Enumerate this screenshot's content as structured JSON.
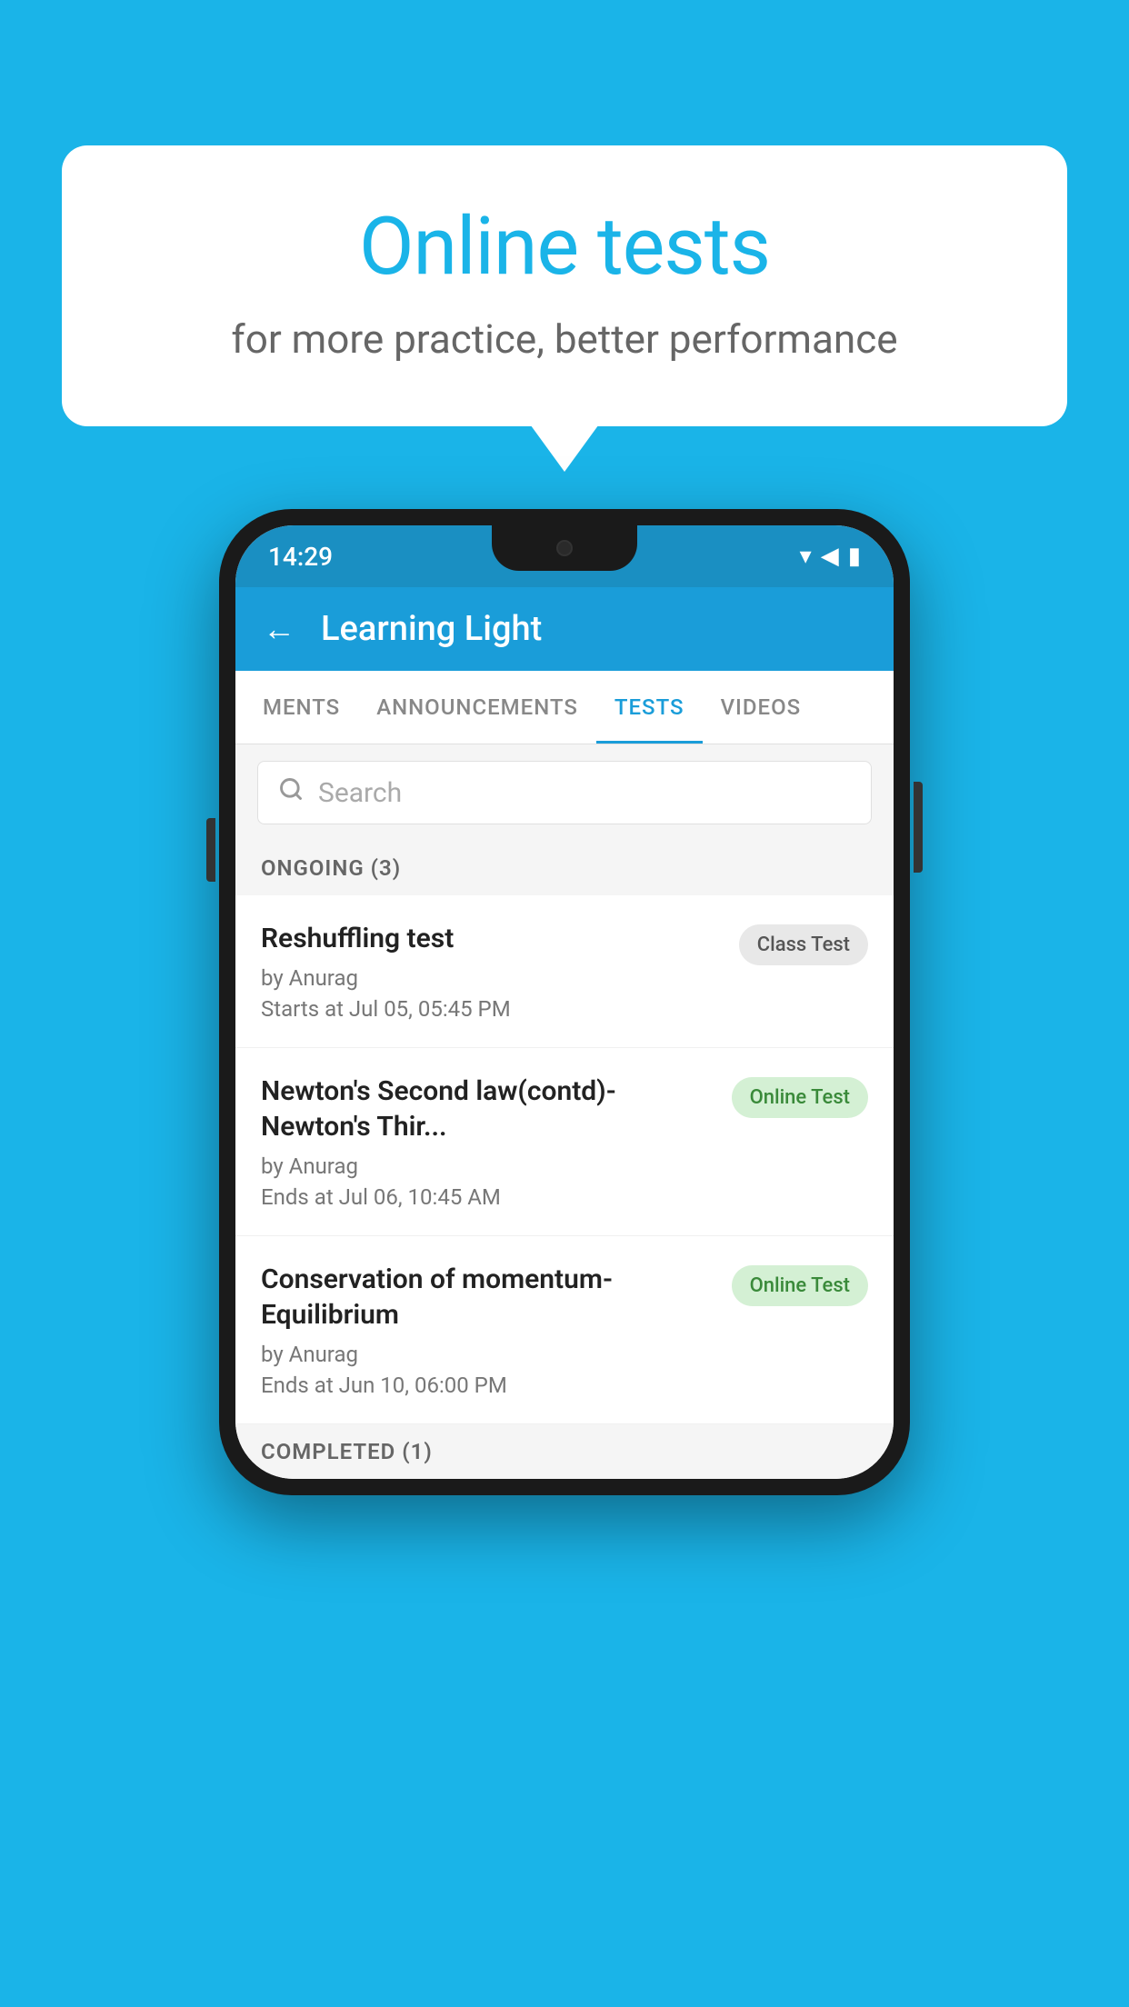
{
  "background_color": "#1ab4e8",
  "speech_bubble": {
    "title": "Online tests",
    "subtitle": "for more practice, better performance"
  },
  "phone": {
    "status_bar": {
      "time": "14:29"
    },
    "header": {
      "title": "Learning Light",
      "back_label": "←"
    },
    "tabs": [
      {
        "label": "MENTS",
        "active": false
      },
      {
        "label": "ANNOUNCEMENTS",
        "active": false
      },
      {
        "label": "TESTS",
        "active": true
      },
      {
        "label": "VIDEOS",
        "active": false
      }
    ],
    "search": {
      "placeholder": "Search"
    },
    "section_ongoing": "ONGOING (3)",
    "test_items": [
      {
        "title": "Reshuffling test",
        "author": "by Anurag",
        "date": "Starts at  Jul 05, 05:45 PM",
        "badge": "Class Test",
        "badge_type": "class"
      },
      {
        "title": "Newton's Second law(contd)-Newton's Thir...",
        "author": "by Anurag",
        "date": "Ends at  Jul 06, 10:45 AM",
        "badge": "Online Test",
        "badge_type": "online"
      },
      {
        "title": "Conservation of momentum-Equilibrium",
        "author": "by Anurag",
        "date": "Ends at  Jun 10, 06:00 PM",
        "badge": "Online Test",
        "badge_type": "online"
      }
    ],
    "section_completed": "COMPLETED (1)"
  }
}
